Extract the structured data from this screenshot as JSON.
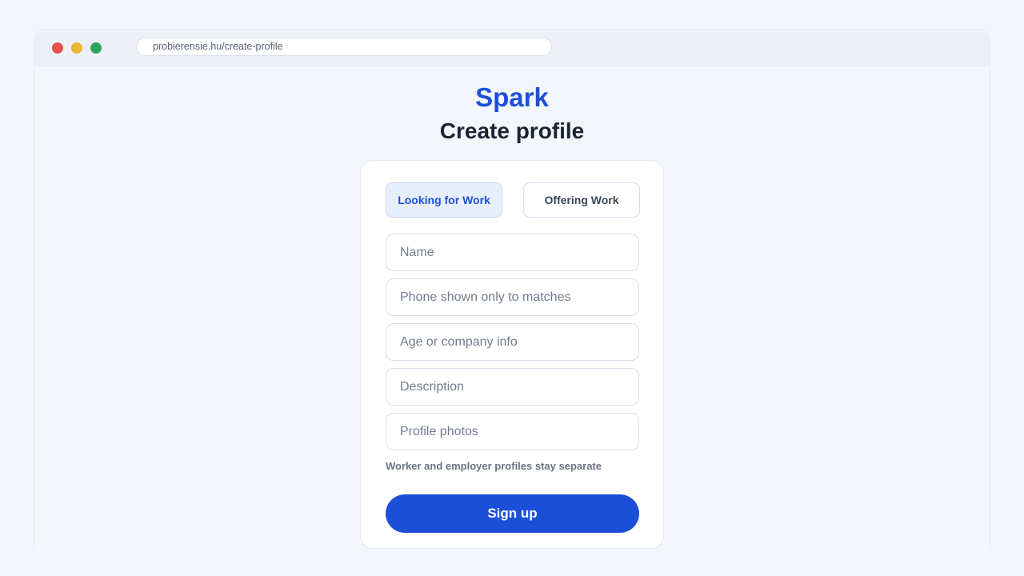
{
  "browser": {
    "url": "probierensie.hu/create-profile"
  },
  "header": {
    "brand": "Spark",
    "title": "Create profile"
  },
  "form": {
    "role_toggle": {
      "options": [
        {
          "label": "Looking for Work",
          "selected": true
        },
        {
          "label": "Offering Work",
          "selected": false
        }
      ]
    },
    "fields": {
      "name": {
        "value": "",
        "placeholder": "Name"
      },
      "phone": {
        "value": "",
        "placeholder": "Phone shown only to matches"
      },
      "age_company": {
        "value": "",
        "placeholder": "Age or company info"
      },
      "description": {
        "value": "",
        "placeholder": "Description"
      },
      "photos": {
        "value": "",
        "placeholder": "Profile photos"
      }
    },
    "hint": "Worker and employer profiles stay separate",
    "submit_label": "Sign up"
  },
  "colors": {
    "accent": "#1d4fd7",
    "window_close": "#e5534b",
    "window_minimize": "#e8b43a",
    "window_maximize": "#2ea35a"
  }
}
